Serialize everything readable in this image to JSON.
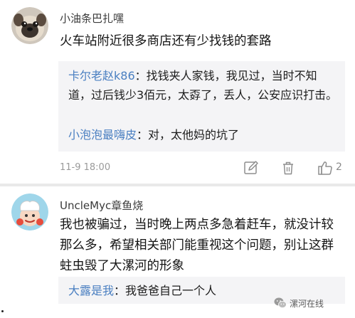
{
  "comments": [
    {
      "username": "小油条巴扎嘿",
      "text": "火车站附近很多商店还有少找钱的套路",
      "replies": [
        {
          "name": "卡尔老赵k86",
          "separator": "：",
          "text": "找钱夹人家钱，我见过，当时不知道，过后钱少3佰元，太孬了，丢人，公安应识打击。"
        },
        {
          "name": "小泡泡最嗨皮",
          "separator": "：",
          "text": "对，太他妈的坑了"
        }
      ],
      "timestamp": "11-9 18:00",
      "like_count": "2",
      "avatar_icon": "pug-dog-avatar"
    },
    {
      "username": "UncleMyc章鱼烧",
      "text": "我也被骗过，当时晚上两点多急着赶车，就没计较那么多，希望相关部门能重视这个问题，别让这群蛀虫毁了大漯河的形象",
      "replies": [
        {
          "name": "大露是我",
          "separator": "：",
          "text": "我爸爸自己一个人"
        }
      ],
      "avatar_icon": "chef-cartoon-avatar"
    }
  ],
  "watermark": {
    "text": "漯河在线",
    "icon": "wechat-logo-icon"
  },
  "colors": {
    "reply_name": "#4a7fc1",
    "reply_bg": "#f4f4f6",
    "meta_gray": "#9a9a9a",
    "divider": "#e9e9e9"
  }
}
